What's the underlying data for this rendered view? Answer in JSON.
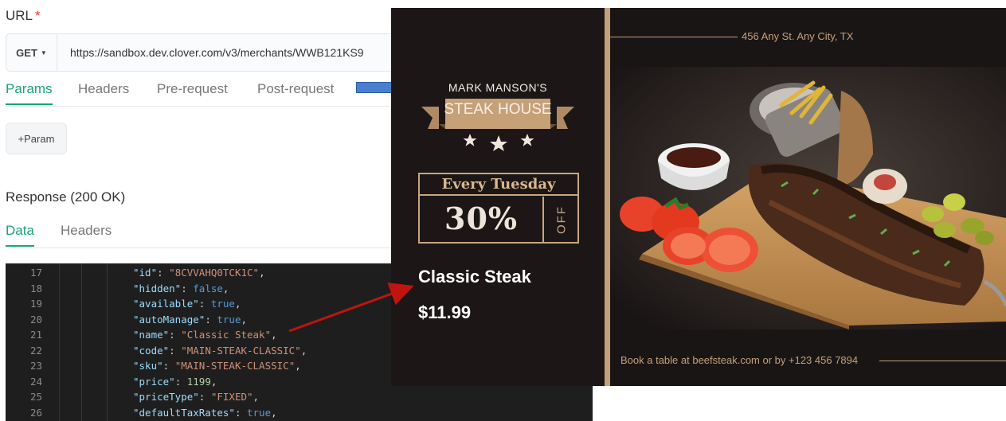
{
  "request": {
    "url_label": "URL",
    "required_mark": "*",
    "method": "GET",
    "url": "https://sandbox.dev.clover.com/v3/merchants/WWB121KS9",
    "tabs": [
      "Params",
      "Headers",
      "Pre-request",
      "Post-request"
    ],
    "active_tab": "Params",
    "add_param_label": "+Param"
  },
  "response": {
    "title": "Response (200 OK)",
    "tabs": [
      "Data",
      "Headers"
    ],
    "active_tab": "Data",
    "lines": [
      {
        "num": "17",
        "key": "\"id\"",
        "value": "\"8CVVAHQ0TCK1C\"",
        "type": "string"
      },
      {
        "num": "18",
        "key": "\"hidden\"",
        "value": "false",
        "type": "bool"
      },
      {
        "num": "19",
        "key": "\"available\"",
        "value": "true",
        "type": "bool"
      },
      {
        "num": "20",
        "key": "\"autoManage\"",
        "value": "true",
        "type": "bool"
      },
      {
        "num": "21",
        "key": "\"name\"",
        "value": "\"Classic Steak\"",
        "type": "string"
      },
      {
        "num": "22",
        "key": "\"code\"",
        "value": "\"MAIN-STEAK-CLASSIC\"",
        "type": "string"
      },
      {
        "num": "23",
        "key": "\"sku\"",
        "value": "\"MAIN-STEAK-CLASSIC\"",
        "type": "string"
      },
      {
        "num": "24",
        "key": "\"price\"",
        "value": "1199",
        "type": "number"
      },
      {
        "num": "25",
        "key": "\"priceType\"",
        "value": "\"FIXED\"",
        "type": "string"
      },
      {
        "num": "26",
        "key": "\"defaultTaxRates\"",
        "value": "true",
        "type": "bool"
      }
    ]
  },
  "flyer": {
    "brand_line1": "MARK MANSON'S",
    "brand_line2": "STEAK HOUSE",
    "promo_day": "Every Tuesday",
    "promo_percent": "30%",
    "promo_off": "OFF",
    "item_name": "Classic Steak",
    "item_price": "$11.99",
    "address": "456 Any St. Any City, TX",
    "booking": "Book a table at beefsteak.com or by +123 456 7894"
  },
  "colors": {
    "accent_green": "#1aa37a",
    "flyer_gold": "#c4a07a",
    "flyer_bg": "#1c1616",
    "arrow_red": "#c0140f"
  }
}
